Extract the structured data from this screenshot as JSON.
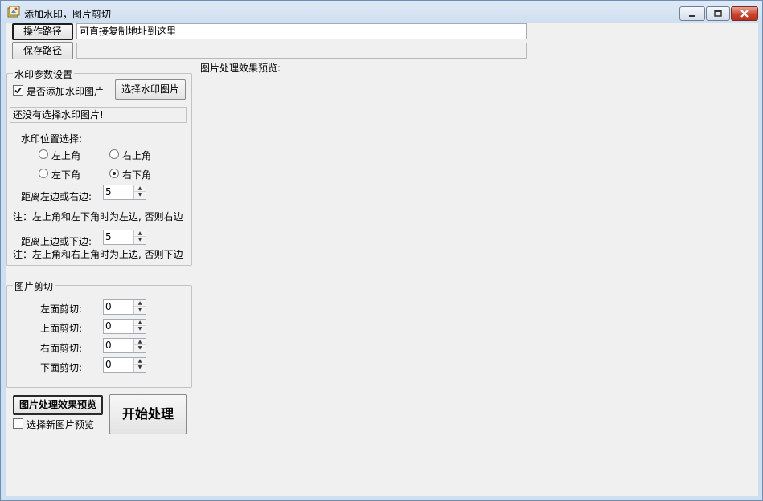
{
  "window": {
    "title": "添加水印，图片剪切"
  },
  "paths": {
    "operate_button": "操作路径",
    "operate_value": "可直接复制地址到这里",
    "save_button": "保存路径",
    "save_value": ""
  },
  "preview_label": "图片处理效果预览:",
  "watermark": {
    "group_title": "水印参数设置",
    "add_checkbox_label": "是否添加水印图片",
    "add_checked": true,
    "select_button": "选择水印图片",
    "status_text": "还没有选择水印图片!",
    "position_label": "水印位置选择:",
    "positions": {
      "top_left": "左上角",
      "top_right": "右上角",
      "bottom_left": "左下角",
      "bottom_right": "右下角"
    },
    "selected_position": "右下角",
    "h_distance_label": "距离左边或右边:",
    "h_distance_value": "5",
    "h_note": "注：左上角和左下角时为左边, 否则右边",
    "v_distance_label": "距离上边或下边:",
    "v_distance_value": "5",
    "v_note": "注：左上角和右上角时为上边, 否则下边"
  },
  "crop": {
    "group_title": "图片剪切",
    "left_label": "左面剪切:",
    "left_value": "0",
    "top_label": "上面剪切:",
    "top_value": "0",
    "right_label": "右面剪切:",
    "right_value": "0",
    "bottom_label": "下面剪切:",
    "bottom_value": "0"
  },
  "actions": {
    "preview_button": "图片处理效果预览",
    "new_preview_label": "选择新图片预览",
    "new_preview_checked": false,
    "start_button": "开始处理"
  },
  "icons": {
    "app": "app-icon",
    "minimize": "minimize-icon",
    "maximize": "maximize-icon",
    "close": "close-icon",
    "check": "checkmark-icon",
    "spin_up": "chevron-up-icon",
    "spin_down": "chevron-down-icon"
  },
  "colors": {
    "titlebar": "#dfe9f5",
    "client_bg": "#f0f0f0",
    "close_button": "#c7402c"
  }
}
